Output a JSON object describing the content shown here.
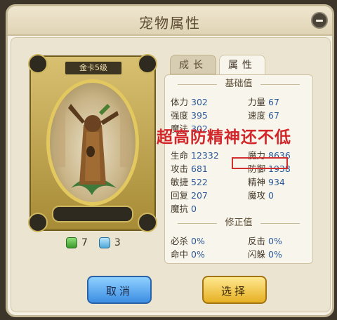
{
  "dialog": {
    "title": "宠物属性"
  },
  "card": {
    "label": "金卡5级"
  },
  "resources": {
    "green_gem_count": "7",
    "blue_gem_count": "3"
  },
  "tabs": [
    {
      "label": "成长",
      "active": false
    },
    {
      "label": "属性",
      "active": true
    }
  ],
  "sections": {
    "base": "基础值",
    "modifier": "修正值"
  },
  "base_stats": [
    {
      "label": "体力",
      "value": "302"
    },
    {
      "label": "力量",
      "value": "67"
    },
    {
      "label": "强度",
      "value": "395"
    },
    {
      "label": "速度",
      "value": "67"
    },
    {
      "label": "魔法",
      "value": "302"
    },
    {
      "label": "生命",
      "value": "12332"
    },
    {
      "label": "魔力",
      "value": "8636"
    },
    {
      "label": "攻击",
      "value": "681"
    },
    {
      "label": "防御",
      "value": "1938"
    },
    {
      "label": "敏捷",
      "value": "522"
    },
    {
      "label": "精神",
      "value": "934"
    },
    {
      "label": "回复",
      "value": "207"
    },
    {
      "label": "魔攻",
      "value": "0"
    },
    {
      "label": "魔抗",
      "value": "0"
    }
  ],
  "modifier_stats": [
    {
      "label": "必杀",
      "value": "0%"
    },
    {
      "label": "反击",
      "value": "0%"
    },
    {
      "label": "命中",
      "value": "0%"
    },
    {
      "label": "闪躲",
      "value": "0%"
    }
  ],
  "overlay_caption": "超高防精神还不低",
  "buttons": {
    "cancel": "取消",
    "select": "选择"
  },
  "colors": {
    "caption_red": "#d2262a",
    "stat_value_blue": "#2d5a9a",
    "cancel_blue": "#3c8ee3",
    "select_gold": "#e6b024"
  }
}
